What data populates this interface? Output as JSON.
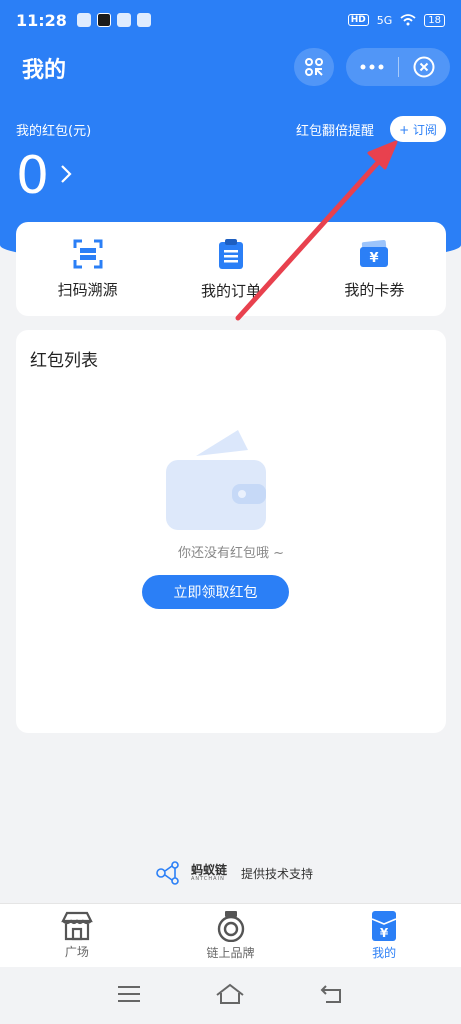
{
  "status_bar": {
    "time": "11:28",
    "network": "5G",
    "hd": "HD",
    "battery": "18"
  },
  "header": {
    "title": "我的"
  },
  "wallet": {
    "label": "我的红包(元)",
    "amount": "0",
    "remind_label": "红包翻倍提醒",
    "subscribe_label": "+ 订阅"
  },
  "quick_actions": [
    {
      "label": "扫码溯源",
      "icon": "scan-trace-icon"
    },
    {
      "label": "我的订单",
      "icon": "order-clipboard-icon"
    },
    {
      "label": "我的卡券",
      "icon": "coupon-icon"
    }
  ],
  "red_packet_list": {
    "title": "红包列表",
    "empty_text": "你还没有红包哦 ~",
    "claim_button": "立即领取红包"
  },
  "footer": {
    "brand_name": "蚂蚁链",
    "brand_sub": "ANTCHAIN",
    "support_text": "提供技术支持"
  },
  "tabbar": {
    "tabs": [
      {
        "label": "广场",
        "icon": "store-icon",
        "active": false
      },
      {
        "label": "链上品牌",
        "icon": "brand-badge-icon",
        "active": false
      },
      {
        "label": "我的",
        "icon": "wallet-yen-icon",
        "active": true
      }
    ]
  },
  "colors": {
    "primary": "#2b7ff6",
    "page_bg": "#f2f3f5",
    "annotation_arrow": "#e8414e"
  }
}
